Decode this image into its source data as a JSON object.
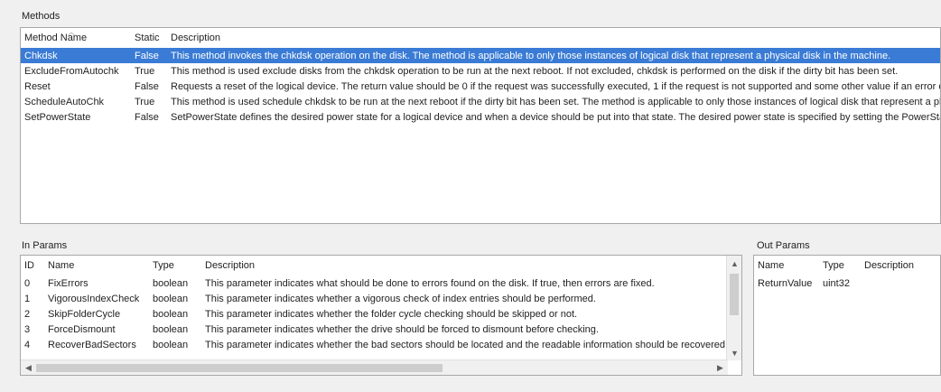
{
  "methods_group": {
    "label": "Methods",
    "columns": [
      "Method Name",
      "Static",
      "Description"
    ],
    "rows": [
      {
        "name": "Chkdsk",
        "static": "False",
        "description": "This method invokes the chkdsk operation on the disk. The method is applicable to only those instances of logical disk that represent a physical disk in the machine.",
        "selected": true
      },
      {
        "name": "ExcludeFromAutochk",
        "static": "True",
        "description": "This method is used exclude disks from the chkdsk operation to be run at the next reboot. If not excluded, chkdsk is performed on the disk if the dirty bit has been set."
      },
      {
        "name": "Reset",
        "static": "False",
        "description": "Requests a reset of the logical device. The return value should be 0 if the request was successfully executed, 1 if the request is not supported and some other value if an error occurred."
      },
      {
        "name": "ScheduleAutoChk",
        "static": "True",
        "description": "This method is used schedule chkdsk to be run at the next reboot if the dirty bit has been set.  The method is applicable to only those instances of logical disk that represent a physical disk."
      },
      {
        "name": "SetPowerState",
        "static": "False",
        "description": "SetPowerState defines the desired power state for a logical device and when a device should be put into that state. The desired power state is specified by setting the PowerState parameter."
      }
    ]
  },
  "in_params_group": {
    "label": "In Params",
    "columns": [
      "ID",
      "Name",
      "Type",
      "Description"
    ],
    "rows": [
      {
        "id": "0",
        "name": "FixErrors",
        "type": "boolean",
        "description": "This parameter indicates what should be done to errors found on the disk. If true, then errors are fixed."
      },
      {
        "id": "1",
        "name": "VigorousIndexCheck",
        "type": "boolean",
        "description": "This parameter indicates whether a vigorous check of index entries should be performed."
      },
      {
        "id": "2",
        "name": "SkipFolderCycle",
        "type": "boolean",
        "description": "This parameter indicates whether the folder cycle checking should be skipped or not."
      },
      {
        "id": "3",
        "name": "ForceDismount",
        "type": "boolean",
        "description": "This parameter indicates whether the drive should be forced to dismount before checking."
      },
      {
        "id": "4",
        "name": "RecoverBadSectors",
        "type": "boolean",
        "description": "This parameter indicates whether the bad sectors should be located and the readable information should be recovered."
      }
    ]
  },
  "out_params_group": {
    "label": "Out Params",
    "columns": [
      "Name",
      "Type",
      "Description"
    ],
    "rows": [
      {
        "name": "ReturnValue",
        "type": "uint32",
        "description": ""
      }
    ]
  },
  "icons": {
    "sort_ascending": "sort-ascending-icon",
    "scroll_up": "scroll-up-arrow-icon",
    "scroll_down": "scroll-down-arrow-icon",
    "scroll_left": "scroll-left-arrow-icon",
    "scroll_right": "scroll-right-arrow-icon"
  },
  "colors": {
    "selection": "#3a7bd5",
    "window_bg": "#f0f0f0",
    "panel_bg": "#ffffff"
  }
}
